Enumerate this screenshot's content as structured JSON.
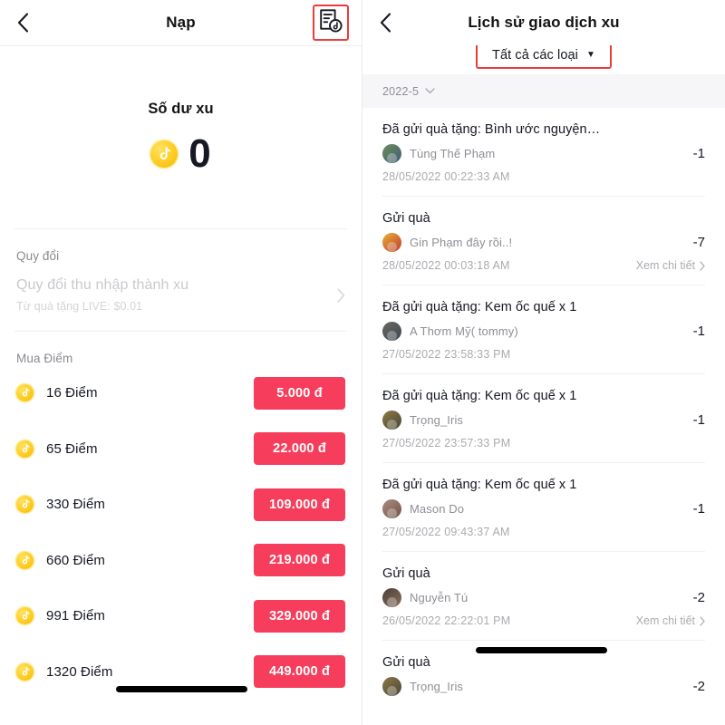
{
  "left_screen": {
    "header": {
      "back_icon": "chevron-left-icon",
      "title": "Nạp",
      "action_icon": "transaction-history-coin-icon",
      "action_highlight_color": "#EC3C3C"
    },
    "balance": {
      "label": "Số dư xu",
      "coin_icon": "tiktok-coin-icon",
      "value": "0"
    },
    "convert_section": {
      "heading": "Quy đổi",
      "row_title": "Quy đổi thu nhập thành xu",
      "row_subtitle": "Từ quà tặng LIVE: $0.01",
      "chevron_icon": "chevron-right-icon"
    },
    "buy_section": {
      "heading": "Mua Điểm",
      "items": [
        {
          "coin_icon": "tiktok-coin-icon",
          "points": "16 Điểm",
          "price": "5.000 đ",
          "redacted": false
        },
        {
          "coin_icon": "tiktok-coin-icon",
          "points": "65 Điểm",
          "price": "22.000 đ",
          "redacted": false
        },
        {
          "coin_icon": "tiktok-coin-icon",
          "points": "330 Điểm",
          "price": "109.000 đ",
          "redacted": false
        },
        {
          "coin_icon": "tiktok-coin-icon",
          "points": "660 Điểm",
          "price": "219.000 đ",
          "redacted": false
        },
        {
          "coin_icon": "tiktok-coin-icon",
          "points": "991 Điểm",
          "price": "329.000 đ",
          "redacted": false
        },
        {
          "coin_icon": "tiktok-coin-icon",
          "points": "1320 Điểm",
          "price": "449.000 đ",
          "redacted": true
        }
      ]
    },
    "price_button_color": "#F63E5C"
  },
  "right_screen": {
    "header": {
      "back_icon": "chevron-left-icon",
      "title": "Lịch sử giao dịch xu",
      "filter": {
        "label": "Tất cả các loại",
        "caret_icon": "caret-down-icon",
        "highlight_color": "#EC3C3C"
      }
    },
    "month_filter": {
      "label": "2022-5",
      "caret_icon": "chevron-down-icon",
      "background": "#F6F6F8"
    },
    "detail_link_label": "Xem chi tiết",
    "detail_chevron_icon": "chevron-right-icon",
    "transactions": [
      {
        "title": "Đã gửi quà tặng: Bình ước nguyện…",
        "user": "Tùng Thế Phạm",
        "avatar_icon": "user-avatar",
        "amount": "-1",
        "date": "28/05/2022 00:22:33 AM",
        "has_detail_link": false,
        "redacted": false
      },
      {
        "title": "Gửi quà",
        "user": "Gin Phạm đây rồi..!",
        "avatar_icon": "user-avatar",
        "amount": "-7",
        "date": "28/05/2022 00:03:18 AM",
        "has_detail_link": true,
        "redacted": false
      },
      {
        "title": "Đã gửi quà tặng: Kem ốc quế x 1",
        "user": "A Thơm Mỹ( tommy)",
        "avatar_icon": "user-avatar",
        "amount": "-1",
        "date": "27/05/2022 23:58:33 PM",
        "has_detail_link": false,
        "redacted": false
      },
      {
        "title": "Đã gửi quà tặng: Kem ốc quế x 1",
        "user": "Trọng_Iris",
        "avatar_icon": "user-avatar",
        "amount": "-1",
        "date": "27/05/2022 23:57:33 PM",
        "has_detail_link": false,
        "redacted": false
      },
      {
        "title": "Đã gửi quà tặng: Kem ốc quế x 1",
        "user": "Mason Do",
        "avatar_icon": "user-avatar",
        "amount": "-1",
        "date": "27/05/2022 09:43:37 AM",
        "has_detail_link": false,
        "redacted": false
      },
      {
        "title": "Gửi quà",
        "user": "Nguyễn Tú",
        "avatar_icon": "user-avatar",
        "amount": "-2",
        "date": "26/05/2022 22:22:01 PM",
        "has_detail_link": true,
        "redacted": false
      },
      {
        "title": "Gửi quà",
        "user": "Trọng_Iris",
        "avatar_icon": "user-avatar",
        "amount": "-2",
        "date": "",
        "has_detail_link": false,
        "redacted": true
      }
    ]
  }
}
